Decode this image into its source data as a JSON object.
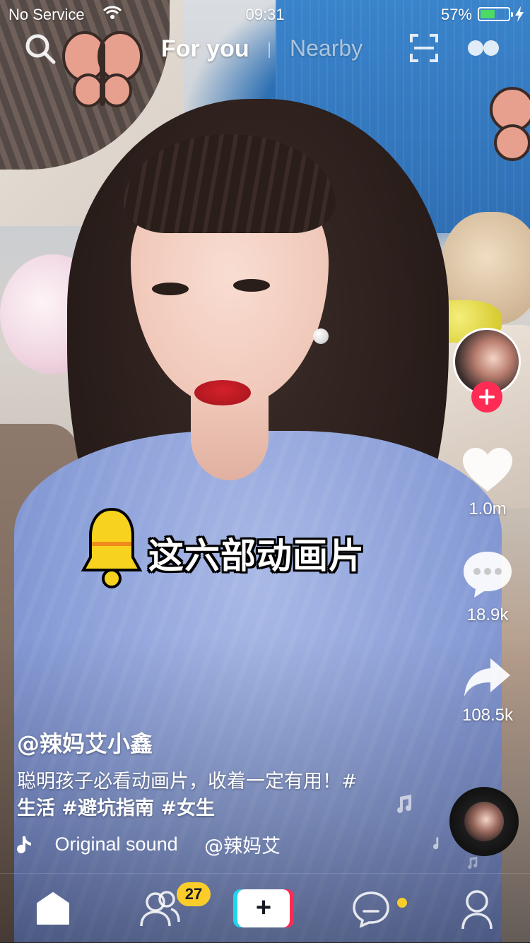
{
  "status_bar": {
    "carrier": "No Service",
    "time": "09:31",
    "battery_percent": "57%",
    "battery_level": 0.57,
    "icons": [
      "wifi-icon",
      "battery-icon",
      "charging-bolt-icon"
    ]
  },
  "top_nav": {
    "tabs": [
      {
        "label": "For you",
        "active": true
      },
      {
        "label": "Nearby",
        "active": false
      }
    ],
    "icons": [
      "search-icon",
      "scan-icon",
      "live-icon"
    ]
  },
  "sticker": {
    "text": "这六部动画片",
    "icon": "bell-icon"
  },
  "right_rail": {
    "likes": "1.0m",
    "comments": "18.9k",
    "shares": "108.5k",
    "icons": [
      "creator-avatar",
      "follow-plus-icon",
      "heart-icon",
      "comment-icon",
      "share-icon"
    ]
  },
  "video_info": {
    "username": "@辣妈艾小鑫",
    "caption_text": "聪明孩子必看动画片，收着一定有用！#",
    "hashtags_line": "生活 #避坑指南 #女生",
    "sound_title": "Original sound",
    "sound_author": "@辣妈艾"
  },
  "bottom_bar": {
    "friends_badge": "27",
    "create_label": "+",
    "icons": [
      "home-icon",
      "friends-icon",
      "create-icon",
      "inbox-icon",
      "profile-icon"
    ]
  },
  "colors": {
    "brand_red": "#fe2c55",
    "brand_cyan": "#20d5ec",
    "badge_yellow": "#facd2a",
    "battery_green": "#4cd964"
  }
}
